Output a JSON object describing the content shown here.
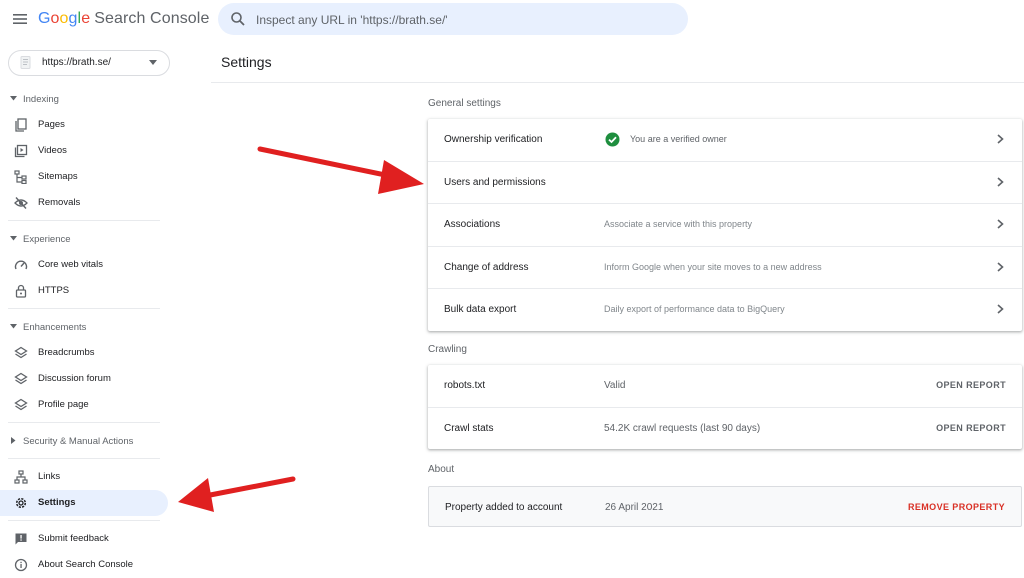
{
  "app": {
    "brand_letters": [
      "G",
      "o",
      "o",
      "g",
      "l",
      "e"
    ],
    "product": "Search Console"
  },
  "search": {
    "placeholder": "Inspect any URL in 'https://brath.se/'"
  },
  "property": {
    "label": "https://brath.se/"
  },
  "sidebar": {
    "sections": [
      {
        "header": "Indexing",
        "items": [
          {
            "label": "Pages",
            "icon": "pages-icon"
          },
          {
            "label": "Videos",
            "icon": "videos-icon"
          },
          {
            "label": "Sitemaps",
            "icon": "sitemaps-icon"
          },
          {
            "label": "Removals",
            "icon": "removals-icon"
          }
        ]
      },
      {
        "header": "Experience",
        "items": [
          {
            "label": "Core web vitals",
            "icon": "gauge-icon"
          },
          {
            "label": "HTTPS",
            "icon": "lock-icon"
          }
        ]
      },
      {
        "header": "Enhancements",
        "items": [
          {
            "label": "Breadcrumbs",
            "icon": "layers-icon"
          },
          {
            "label": "Discussion forum",
            "icon": "layers-icon"
          },
          {
            "label": "Profile page",
            "icon": "layers-icon"
          }
        ]
      },
      {
        "header": "Security & Manual Actions",
        "items": []
      }
    ],
    "links": "Links",
    "settings": "Settings",
    "submit_feedback": "Submit feedback",
    "about": "About Search Console"
  },
  "main": {
    "title": "Settings",
    "general_label": "General settings",
    "general": [
      {
        "label": "Ownership verification",
        "desc": "You are a verified owner",
        "verified": true
      },
      {
        "label": "Users and permissions",
        "desc": ""
      },
      {
        "label": "Associations",
        "desc": "Associate a service with this property"
      },
      {
        "label": "Change of address",
        "desc": "Inform Google when your site moves to a new address"
      },
      {
        "label": "Bulk data export",
        "desc": "Daily export of performance data to BigQuery"
      }
    ],
    "crawling_label": "Crawling",
    "crawling": [
      {
        "label": "robots.txt",
        "desc": "Valid",
        "action": "OPEN REPORT"
      },
      {
        "label": "Crawl stats",
        "desc": "54.2K crawl requests (last 90 days)",
        "action": "OPEN REPORT"
      }
    ],
    "about_label": "About",
    "about": {
      "label": "Property added to account",
      "desc": "26 April 2021",
      "action": "REMOVE PROPERTY"
    }
  },
  "colors": {
    "accent": "#e8f0fe",
    "verified": "#1e8e3e",
    "danger": "#d93025",
    "arrow": "#e02020"
  }
}
